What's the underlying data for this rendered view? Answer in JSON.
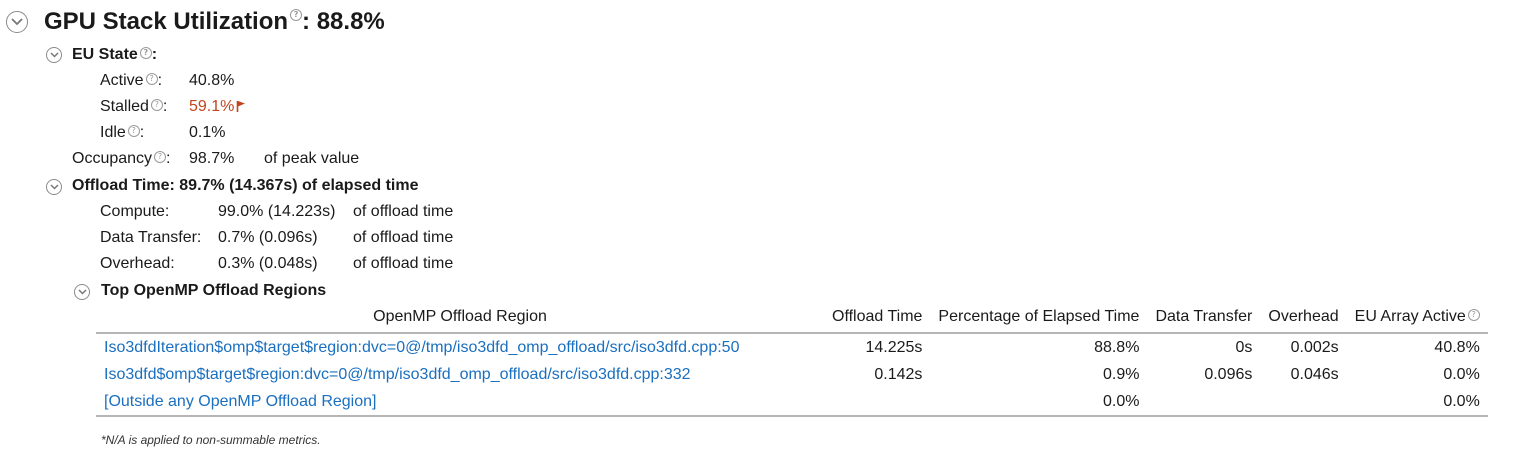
{
  "header": {
    "title": "GPU Stack Utilization",
    "help": "?",
    "value": ": 88.8%"
  },
  "eu_state": {
    "title": "EU State",
    "help": "?",
    "colon": ":",
    "rows": [
      {
        "label": "Active",
        "colon": ":",
        "value": "40.8%"
      },
      {
        "label": "Stalled",
        "colon": ":",
        "value": "59.1%"
      },
      {
        "label": "Idle",
        "colon": ":",
        "value": "0.1%"
      }
    ],
    "status_colors": {
      "warning": "#c0461e"
    }
  },
  "occupancy": {
    "label": "Occupancy",
    "colon": ":",
    "value": "98.7%",
    "suffix": "of peak value"
  },
  "offload_time": {
    "title": "Offload Time: 89.7% (14.367s) of elapsed time",
    "rows": [
      {
        "label": "Compute:",
        "value": "99.0% (14.223s)",
        "suffix": "of offload time"
      },
      {
        "label": "Data Transfer:",
        "value": "0.7% (0.096s)",
        "suffix": "of offload time"
      },
      {
        "label": "Overhead:",
        "value": "0.3% (0.048s)",
        "suffix": "of offload time"
      }
    ]
  },
  "regions": {
    "title": "Top OpenMP Offload Regions",
    "columns": [
      "OpenMP Offload Region",
      "Offload Time",
      "Percentage of Elapsed Time",
      "Data Transfer",
      "Overhead",
      "EU Array Active"
    ],
    "rows": [
      {
        "region": "Iso3dfdIteration$omp$target$region:dvc=0@/tmp/iso3dfd_omp_offload/src/iso3dfd.cpp:50",
        "offload_time": "14.225s",
        "pct_elapsed": "88.8%",
        "data_transfer": "0s",
        "overhead": "0.002s",
        "eu_active": "40.8%"
      },
      {
        "region": "Iso3dfd$omp$target$region:dvc=0@/tmp/iso3dfd_omp_offload/src/iso3dfd.cpp:332",
        "offload_time": "0.142s",
        "pct_elapsed": "0.9%",
        "data_transfer": "0.096s",
        "overhead": "0.046s",
        "eu_active": "0.0%"
      },
      {
        "region": "[Outside any OpenMP Offload Region]",
        "offload_time": "",
        "pct_elapsed": "0.0%",
        "data_transfer": "",
        "overhead": "",
        "eu_active": "0.0%"
      }
    ],
    "footnote": "*N/A is applied to non-summable metrics."
  },
  "icons": {
    "toggle": "chevron-down-icon",
    "help": "help-icon",
    "flag": "flag-icon"
  }
}
